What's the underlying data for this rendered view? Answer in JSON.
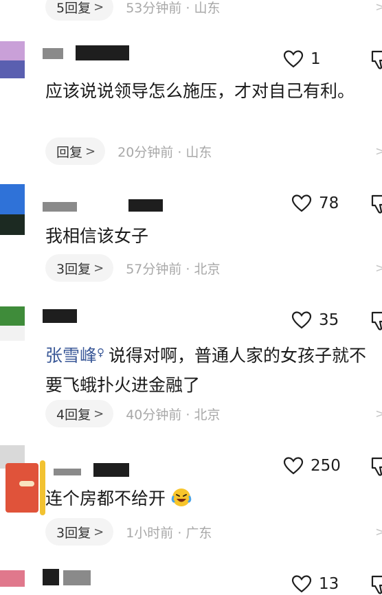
{
  "top_meta": {
    "replies": "5回复",
    "time_loc": "53分钟前 · 山东"
  },
  "comments": [
    {
      "likes": "1",
      "text": "应该说说领导怎么施压，才对自己有利。",
      "replies": "回复",
      "time_loc": "20分钟前 · 山东"
    },
    {
      "likes": "78",
      "text": "我相信该女子",
      "replies": "3回复",
      "time_loc": "57分钟前 · 北京"
    },
    {
      "likes": "35",
      "mention": "张雪峰",
      "text": "说得对啊，普通人家的女孩子就不要飞蛾扑火进金融了",
      "replies": "4回复",
      "time_loc": "40分钟前 · 北京"
    },
    {
      "likes": "250",
      "text": "连个房都不给开",
      "replies": "3回复",
      "time_loc": "1小时前 · 广东"
    },
    {
      "likes": "13"
    }
  ],
  "icons": {
    "like": "heart-outline-icon",
    "dislike": "thumbs-down-icon",
    "reply_chevron": "chevron-right-icon",
    "emoji": "laughing-tears-emoji-icon",
    "mention_marker": "mention-search-icon"
  },
  "colors": {
    "mention": "#3b5998",
    "meta_text": "#a8a8a8",
    "pill_bg": "#f4f4f4"
  }
}
